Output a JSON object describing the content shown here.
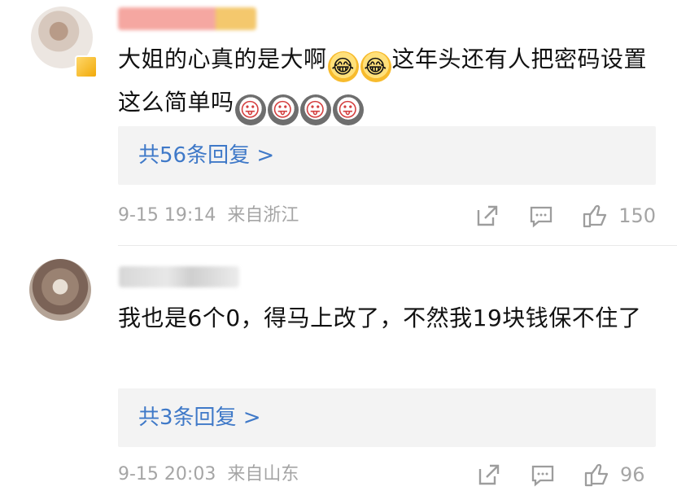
{
  "comments": [
    {
      "text_before_emoji": "大姐的心真的是大啊",
      "text_after_emoji": "这年头还有人把密码设置这么简单吗",
      "reply_label": "共56条回复 >",
      "time": "9-15 19:14",
      "location": "来自浙江",
      "likes": "150"
    },
    {
      "text": "我也是6个0，得马上改了，不然我19块钱保不住了",
      "reply_label": "共3条回复 >",
      "time": "9-15 20:03",
      "location": "来自山东",
      "likes": "96"
    }
  ],
  "icons": {
    "share": "share-icon",
    "comment": "comment-icon",
    "like": "like-icon"
  },
  "colors": {
    "reply_link": "#3f79c8",
    "meta": "#a5a5a5",
    "reply_background": "#f3f3f3"
  }
}
